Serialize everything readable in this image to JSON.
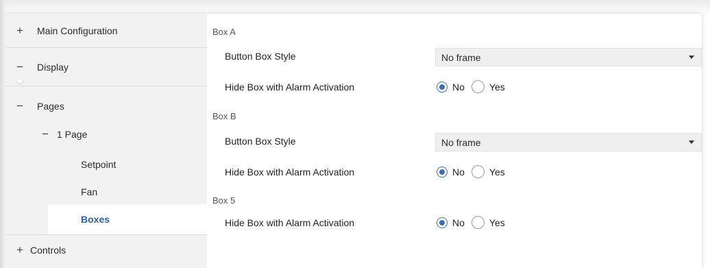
{
  "sidebar": {
    "items": [
      {
        "label": "Main Configuration",
        "toggle": "+"
      },
      {
        "label": "Display",
        "toggle": "−"
      },
      {
        "label": "Pages",
        "toggle": "−"
      },
      {
        "label": "1 Page",
        "toggle": "−"
      },
      {
        "label": "Setpoint",
        "toggle": ""
      },
      {
        "label": "Fan",
        "toggle": ""
      },
      {
        "label": "Boxes",
        "toggle": ""
      },
      {
        "label": "Controls",
        "toggle": "+"
      }
    ],
    "active_item": "Boxes"
  },
  "main": {
    "box_a": {
      "title": "Box A",
      "button_box_style": {
        "label": "Button Box Style",
        "value": "No frame"
      },
      "hide_box": {
        "label": "Hide Box with Alarm Activation",
        "options": [
          "No",
          "Yes"
        ],
        "selected": "No"
      }
    },
    "box_b": {
      "title": "Box B",
      "button_box_style": {
        "label": "Button Box Style",
        "value": "No frame"
      },
      "hide_box": {
        "label": "Hide Box with Alarm Activation",
        "options": [
          "No",
          "Yes"
        ],
        "selected": "No"
      }
    },
    "box_5": {
      "title": "Box 5",
      "hide_box": {
        "label": "Hide Box with Alarm Activation",
        "options": [
          "No",
          "Yes"
        ],
        "selected": "No"
      }
    }
  },
  "colors": {
    "sidebar_bg": "#f2f2f2",
    "active_text": "#2b63a8",
    "radio_selected": "#3c6fb0",
    "dropdown_bg": "#efefef"
  }
}
